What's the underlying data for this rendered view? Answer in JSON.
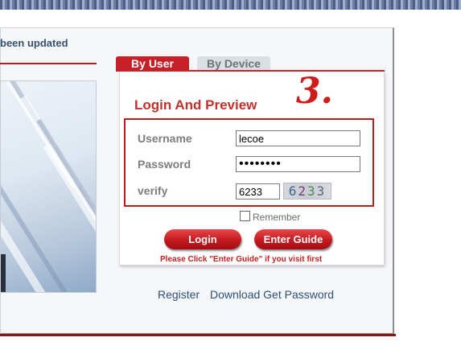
{
  "notice": {
    "text": "been updated"
  },
  "tabs": [
    {
      "label": "By User",
      "active": true
    },
    {
      "label": "By Device",
      "active": false
    }
  ],
  "annotation": {
    "text": "3."
  },
  "login": {
    "title": "Login And Preview",
    "username_label": "Username",
    "username_value": "lecoe",
    "password_label": "Password",
    "password_value": "••••••••",
    "verify_label": "verify",
    "verify_value": "6233",
    "captcha_chars": [
      "6",
      "2",
      "3",
      "3"
    ],
    "remember_label": "Remember",
    "remember_checked": false,
    "login_button": "Login",
    "guide_button": "Enter Guide",
    "hint": "Please Click \"Enter Guide\" if you visit first"
  },
  "links": {
    "register": "Register",
    "download": "Download Get Password"
  },
  "colors": {
    "accent_red": "#c52027",
    "link_blue": "#2b4f7c",
    "label_gray": "#7d7d7d"
  }
}
